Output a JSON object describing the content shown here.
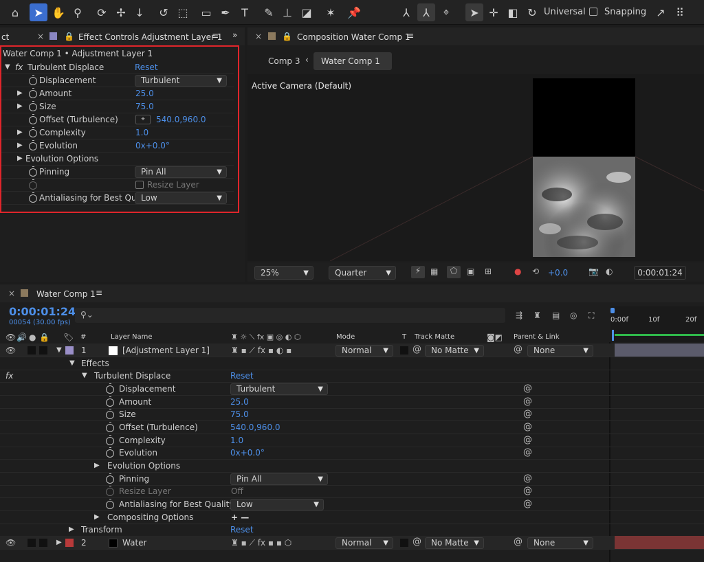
{
  "toolbar": {
    "universal_label": "Universal",
    "snapping_label": "Snapping"
  },
  "effect_panel": {
    "tab_left": "ct",
    "tab_title": "Effect Controls Adjustment Layer 1",
    "layer_path": "Water Comp 1 • Adjustment Layer 1",
    "effect_name": "Turbulent Displace",
    "reset": "Reset",
    "props": [
      {
        "label": "Displacement",
        "value": "Turbulent"
      },
      {
        "label": "Amount",
        "value": "25.0"
      },
      {
        "label": "Size",
        "value": "75.0"
      },
      {
        "label": "Offset (Turbulence)",
        "value": "540.0,960.0"
      },
      {
        "label": "Complexity",
        "value": "1.0"
      },
      {
        "label": "Evolution",
        "value": "0x+0.0°"
      },
      {
        "label": "Evolution Options",
        "value": ""
      },
      {
        "label": "Pinning",
        "value": "Pin All"
      },
      {
        "label": "",
        "value": "Resize Layer"
      },
      {
        "label": "Antialiasing for Best Quali",
        "value": "Low"
      }
    ]
  },
  "comp_panel": {
    "tab_title": "Composition Water Comp 1",
    "crumb1": "Comp 3",
    "crumb2": "Water Comp 1",
    "camera": "Active Camera (Default)",
    "zoom": "25%",
    "resolution": "Quarter",
    "exposure": "+0.0",
    "timecode": "0:00:01:24"
  },
  "timeline": {
    "tab_title": "Water Comp 1",
    "timecode": "0:00:01:24",
    "frames": "00054 (30.00 fps)",
    "search_placeholder": "",
    "cols": {
      "hash": "#",
      "layer_name": "Layer Name",
      "mode": "Mode",
      "t": "T",
      "track_matte": "Track Matte",
      "parent": "Parent & Link"
    },
    "ruler": [
      "0:00f",
      "10f",
      "20f"
    ],
    "layer1": {
      "num": "1",
      "name": "[Adjustment Layer 1]",
      "mode": "Normal",
      "matte": "No Matte",
      "parent": "None"
    },
    "effects_label": "Effects",
    "effect_name": "Turbulent Displace",
    "reset": "Reset",
    "props": [
      {
        "label": "Displacement",
        "value": "Turbulent"
      },
      {
        "label": "Amount",
        "value": "25.0"
      },
      {
        "label": "Size",
        "value": "75.0"
      },
      {
        "label": "Offset (Turbulence)",
        "value": "540.0,960.0"
      },
      {
        "label": "Complexity",
        "value": "1.0"
      },
      {
        "label": "Evolution",
        "value": "0x+0.0°"
      },
      {
        "label": "Evolution Options",
        "value": ""
      },
      {
        "label": "Pinning",
        "value": "Pin All"
      },
      {
        "label": "Resize Layer",
        "value": "Off"
      },
      {
        "label": "Antialiasing for Best Quality",
        "value": "Low"
      },
      {
        "label": "Compositing Options",
        "value": "+ —"
      }
    ],
    "transform": "Transform",
    "transform_reset": "Reset",
    "layer2": {
      "num": "2",
      "name": "Water",
      "mode": "Normal",
      "matte": "No Matte",
      "parent": "None"
    }
  },
  "colors": {
    "accent": "#4d8fe8",
    "highlight_box": "#e0252b",
    "layer1_label": "#9a8fc8",
    "layer2_label": "#b83a3a"
  }
}
